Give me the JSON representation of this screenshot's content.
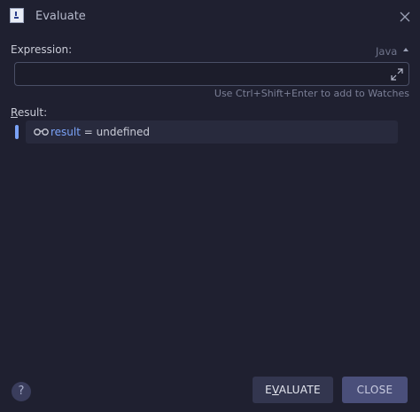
{
  "window": {
    "title": "Evaluate",
    "icon": "java-app-icon",
    "close_icon": "close-icon"
  },
  "expression": {
    "label": "Expression:",
    "value": "",
    "language": "Java",
    "hint": "Use Ctrl+Shift+Enter to add to Watches"
  },
  "result": {
    "label_first": "R",
    "label_rest": "esult:",
    "name": "result",
    "separator": " = ",
    "value": "undefined"
  },
  "footer": {
    "help_label": "?",
    "evaluate_first": "E",
    "evaluate_mnemonic": "V",
    "evaluate_rest": "ALUATE",
    "close_label": "CLOSE"
  },
  "colors": {
    "background": "#1f2030",
    "accent": "#7aa2f7",
    "result_row": "#282a3d",
    "evaluate_button": "#33364f",
    "close_button": "#4a4f7a"
  }
}
